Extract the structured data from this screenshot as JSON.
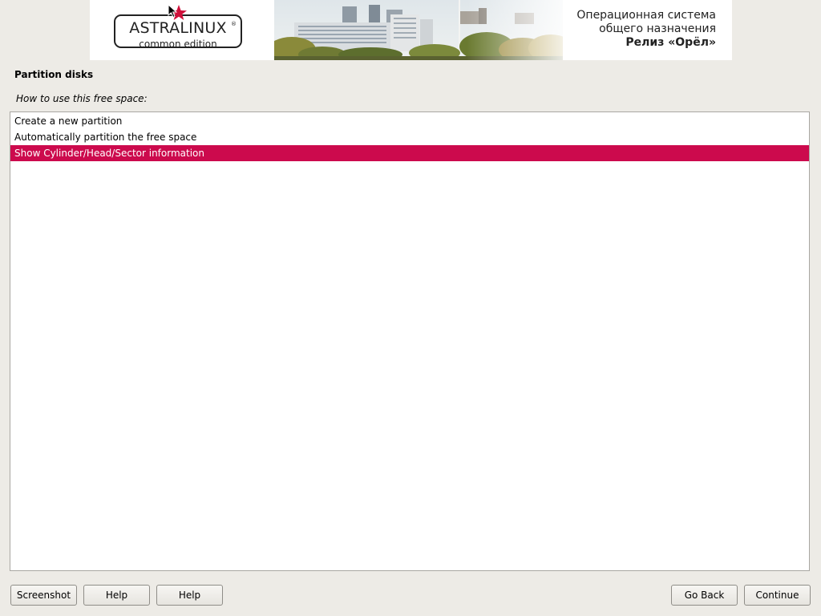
{
  "banner": {
    "logo_main": "ASTRALINUX",
    "logo_sub": "common edition",
    "logo_reg": "®",
    "os_line1": "Операционная система",
    "os_line2": "общего назначения",
    "release": "Релиз «Орёл»"
  },
  "page": {
    "title": "Partition disks",
    "question": "How to use this free space:"
  },
  "options": [
    {
      "label": "Create a new partition",
      "selected": false
    },
    {
      "label": "Automatically partition the free space",
      "selected": false
    },
    {
      "label": "Show Cylinder/Head/Sector information",
      "selected": true
    }
  ],
  "buttons": {
    "screenshot": "Screenshot",
    "help1": "Help",
    "help2": "Help",
    "go_back": "Go Back",
    "continue": "Continue"
  },
  "colors": {
    "selection": "#cc0a4d",
    "background": "#edebe6",
    "logo_star": "#d0103a"
  },
  "icons": [
    "star-icon",
    "mouse-pointer-icon"
  ]
}
